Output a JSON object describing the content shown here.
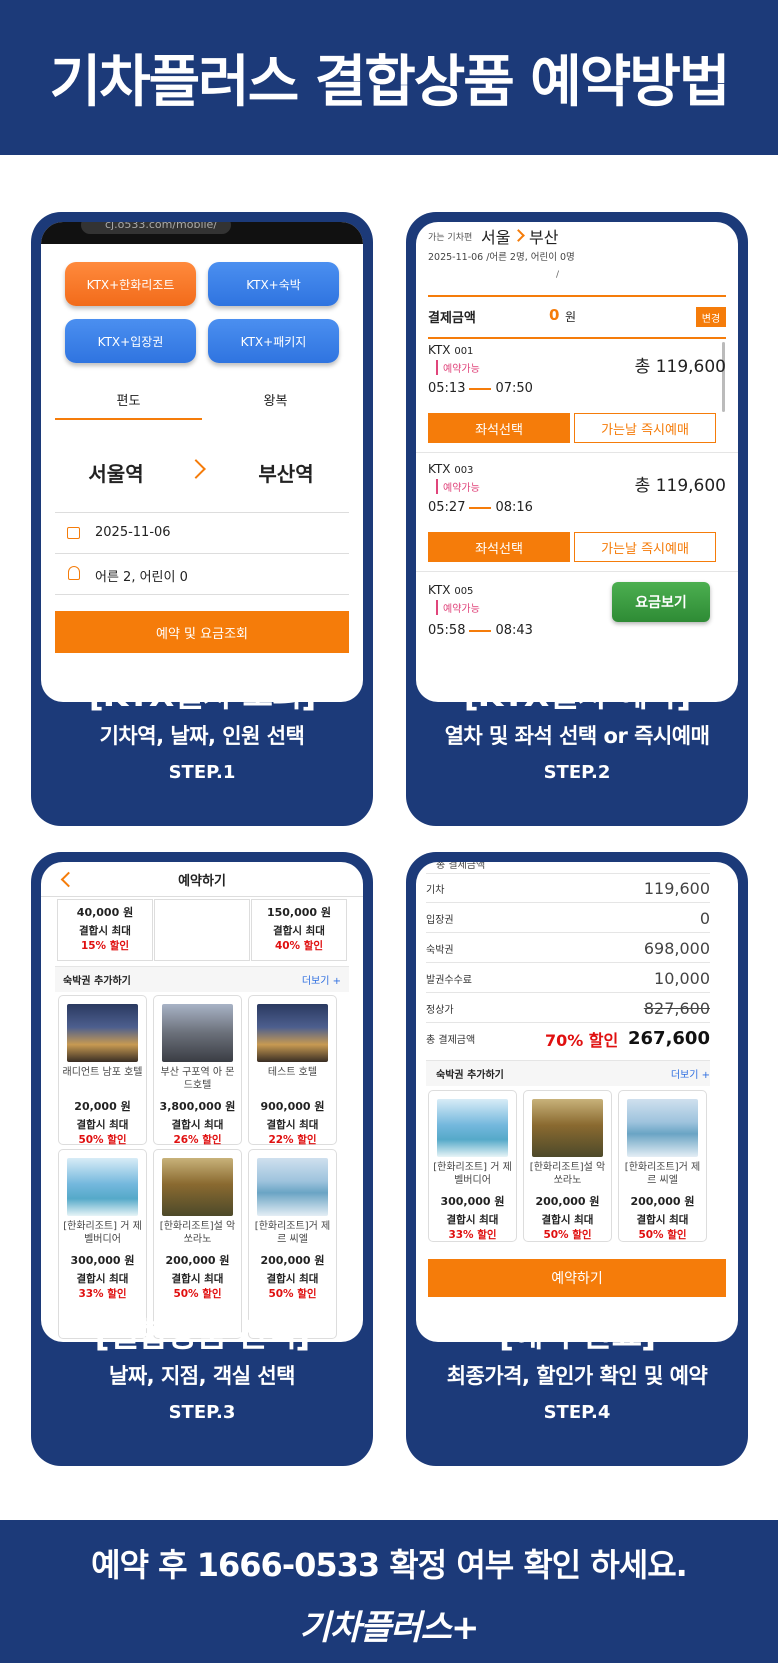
{
  "header": {
    "title": "기차플러스 결합상품 예약방법"
  },
  "step1": {
    "url": "cj.o533.com/mobile/",
    "buttons": [
      "KTX+한화리조트",
      "KTX+숙박",
      "KTX+입장권",
      "KTX+패키지"
    ],
    "tab_oneway": "편도",
    "tab_round": "왕복",
    "from_station": "서울역",
    "to_station": "부산역",
    "date": "2025-11-06",
    "people": "어른 2, 어린이 0",
    "search_button": "예약 및 요금조회",
    "caption_title": "[KTX열차 조회]",
    "caption_sub": "기차역, 날짜, 인원 선택",
    "caption_step": "STEP.1"
  },
  "step2": {
    "label_small": "가는 기차편",
    "route_from": "서울",
    "route_to": "부산",
    "info": "2025-11-06 /어른 2명, 어린이 0명",
    "slash": "/",
    "pay_label": "결제금액",
    "pay_amount": "0",
    "pay_unit": "원",
    "change_button": "변경",
    "trains": [
      {
        "name": "KTX",
        "no": "001",
        "status": "예약가능",
        "dep": "05:13",
        "arr": "07:50",
        "total": "총 119,600"
      },
      {
        "name": "KTX",
        "no": "003",
        "status": "예약가능",
        "dep": "05:27",
        "arr": "08:16",
        "total": "총 119,600"
      },
      {
        "name": "KTX",
        "no": "005",
        "status": "예약가능",
        "dep": "05:58",
        "arr": "08:43"
      }
    ],
    "seat_button": "좌석선택",
    "instant_button": "가는날 즉시예매",
    "fare_button": "요금보기",
    "caption_title": "[KTX열차 예약]",
    "caption_sub": "열차 및 좌석 선택 or 즉시예매",
    "caption_step": "STEP.2"
  },
  "step3": {
    "page_title": "예약하기",
    "top_items": [
      {
        "price": "40,000 원",
        "max": "결합시 최대",
        "disc": "15% 할인"
      },
      {
        "price": "150,000 원",
        "max": "결합시 최대",
        "disc": "40% 할인"
      }
    ],
    "section_title": "숙박권 추가하기",
    "more": "더보기 +",
    "items": [
      {
        "name": "래디언트 남포 호텔",
        "price": "20,000 원",
        "max": "결합시 최대",
        "disc": "50% 할인"
      },
      {
        "name": "부산 구포역 아 몬드호텔",
        "price": "3,800,000 원",
        "max": "결합시 최대",
        "disc": "26% 할인"
      },
      {
        "name": "테스트 호텔",
        "price": "900,000 원",
        "max": "결합시 최대",
        "disc": "22% 할인"
      },
      {
        "name": "[한화리조트] 거 제 벨버디어",
        "price": "300,000 원",
        "max": "결합시 최대",
        "disc": "33% 할인"
      },
      {
        "name": "[한화리조트]설 악 쏘라노",
        "price": "200,000 원",
        "max": "결합시 최대",
        "disc": "50% 할인"
      },
      {
        "name": "[한화리조트]거 제 르 씨엘",
        "price": "200,000 원",
        "max": "결합시 최대",
        "disc": "50% 할인"
      }
    ],
    "caption_title": "[결합상품 선택]",
    "caption_sub": "날짜, 지점, 객실 선택",
    "caption_step": "STEP.3"
  },
  "step4": {
    "cut_title": "총 결제금액",
    "rows": [
      {
        "label": "기차",
        "value": "119,600"
      },
      {
        "label": "입장권",
        "value": "0"
      },
      {
        "label": "숙박권",
        "value": "698,000"
      },
      {
        "label": "발권수수료",
        "value": "10,000"
      },
      {
        "label": "정상가",
        "value": "827,600"
      }
    ],
    "total_label": "총 결제금액",
    "total_disc": "70% 할인",
    "total_value": "267,600",
    "section_title": "숙박권 추가하기",
    "more": "더보기 +",
    "items": [
      {
        "name": "[한화리조트] 거 제 벨버디어",
        "price": "300,000 원",
        "max": "결합시 최대",
        "disc": "33% 할인"
      },
      {
        "name": "[한화리조트]설 악 쏘라노",
        "price": "200,000 원",
        "max": "결합시 최대",
        "disc": "50% 할인"
      },
      {
        "name": "[한화리조트]거 제 르 씨엘",
        "price": "200,000 원",
        "max": "결합시 최대",
        "disc": "50% 할인"
      }
    ],
    "book_button": "예약하기",
    "caption_title": "[예약 완료]",
    "caption_sub": "최종가격, 할인가 확인 및 예약",
    "caption_step": "STEP.4"
  },
  "footer": {
    "notice": "예약 후 1666-0533 확정 여부 확인 하세요.",
    "brand": "기차플러스+"
  }
}
